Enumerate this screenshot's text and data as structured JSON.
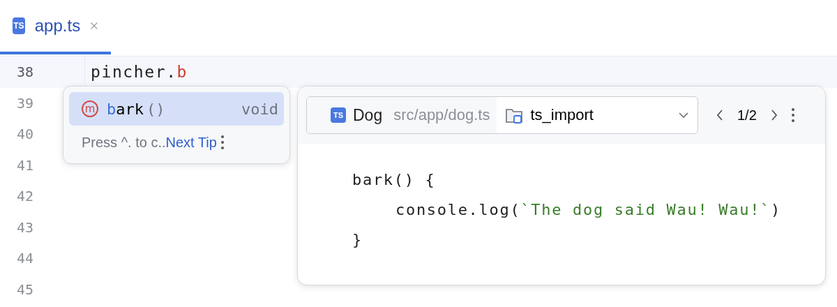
{
  "tab": {
    "badge": "TS",
    "title": "app.ts",
    "selected": true
  },
  "editor": {
    "lines": [
      {
        "number": "38",
        "current": true,
        "tokens": [
          {
            "kind": "plain",
            "text": "pincher."
          },
          {
            "kind": "typed",
            "text": "b"
          }
        ]
      },
      {
        "number": "39",
        "current": false
      },
      {
        "number": "40",
        "current": false
      },
      {
        "number": "41",
        "current": false
      },
      {
        "number": "42",
        "current": false
      },
      {
        "number": "43",
        "current": false
      },
      {
        "number": "44",
        "current": false
      },
      {
        "number": "45",
        "current": false
      }
    ]
  },
  "completion": {
    "items": [
      {
        "icon": "m",
        "match": "b",
        "rest": "ark",
        "params": "()",
        "type": "void",
        "selected": true
      }
    ],
    "hint": {
      "text": "Press ^. to c..",
      "link": "Next Tip"
    }
  },
  "doc": {
    "badge": "TS",
    "name": "Dog",
    "path": "src/app/dog.ts",
    "module": "ts_import",
    "pager": "1/2",
    "code": [
      {
        "tokens": [
          {
            "kind": "plain",
            "text": "bark() {"
          }
        ],
        "children": [
          {
            "tokens": [
              {
                "kind": "plain",
                "text": "console.log("
              },
              {
                "kind": "string",
                "text": "`The dog said Wau! Wau!`"
              },
              {
                "kind": "plain",
                "text": ")"
              }
            ]
          }
        ]
      },
      {
        "tokens": [
          {
            "kind": "plain",
            "text": "}"
          }
        ]
      }
    ]
  }
}
